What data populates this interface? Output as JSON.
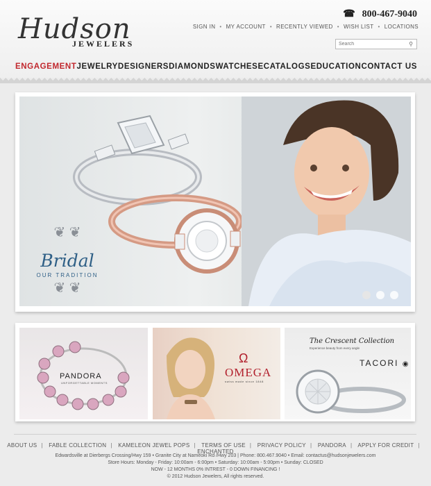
{
  "header": {
    "logo_script": "Hudson",
    "logo_sub": "JEWELERS",
    "phone": "800-467-9040",
    "phone_icon": "phone-icon",
    "utility_links": [
      "SIGN IN",
      "MY ACCOUNT",
      "RECENTLY VIEWED",
      "WISH LIST",
      "LOCATIONS"
    ],
    "search_placeholder": "Search",
    "search_icon": "search-icon"
  },
  "main_nav": [
    {
      "label": "ENGAGEMENT",
      "active": true
    },
    {
      "label": "JEWELRY"
    },
    {
      "label": "DESIGNERS"
    },
    {
      "label": "DIAMONDS"
    },
    {
      "label": "WATCHES"
    },
    {
      "label": "ECATALOGS"
    },
    {
      "label": "EDUCATION"
    },
    {
      "label": "CONTACT US"
    }
  ],
  "hero": {
    "title": "Bridal",
    "subtitle": "OUR TRADITION",
    "slides": 3,
    "active_slide": 1
  },
  "promos": {
    "pandora": {
      "brand": "PANDORA",
      "tagline": "UNFORGETTABLE MOMENTS"
    },
    "omega": {
      "brand": "OMEGA",
      "tagline": "swiss made since 1848"
    },
    "tacori": {
      "title": "The Crescent Collection",
      "tagline": "Experience beauty from every angle",
      "brand": "TACORI"
    }
  },
  "footer": {
    "links": [
      "ABOUT US",
      "FABLE COLLECTION",
      "KAMELEON JEWEL POPS",
      "TERMS OF USE",
      "PRIVACY POLICY",
      "PANDORA",
      "APPLY FOR CREDIT",
      "ENCHANTED"
    ],
    "address": "Edwardsville at Dierbergs Crossing/Hwy 159 • Granite City at Nameoki Rd /Hwy 203 | Phone: 800.467.9040 • Email: contactus@hudsonjewelers.com",
    "hours": "Store Hours: Monday - Friday: 10:00am - 6:00pm • Saturday: 10:00am - 5:00pm • Sunday: CLOSED",
    "financing": "NOW - 12 MONTHS 0% INTREST - 0 DOWN FINANCING !",
    "copyright": "© 2012 Hudson Jewelers, All rights reserved."
  }
}
